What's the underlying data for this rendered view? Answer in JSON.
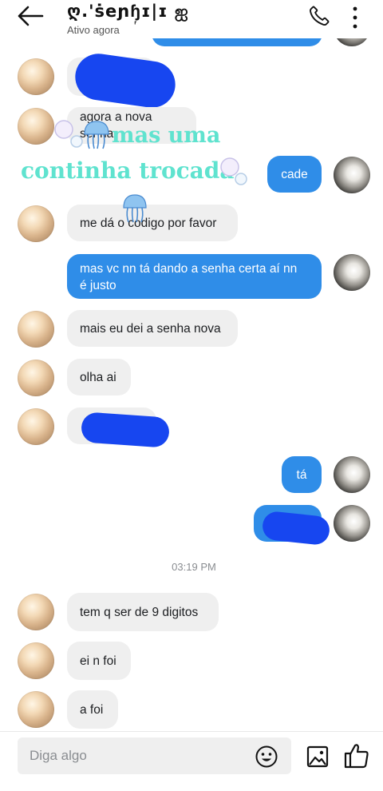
{
  "header": {
    "contact_name": "ღ.'ṡeɲɧ᷊ɪ|ɪ ஐ",
    "status": "Ativo agora"
  },
  "overlay": {
    "line1": "mas uma",
    "line2": "continha trocada"
  },
  "messages": {
    "m2_text": "agora a nova senha",
    "m3_text": "cade",
    "m4_text": "me dá o codigo por favor",
    "m5_line1": "mas vc nn tá dando a senha certa aí nn",
    "m5_line2": "é justo",
    "m6_text": "mais eu dei a senha nova",
    "m7_text": "olha ai",
    "m9_text": "tá",
    "timestamp": "03:19 PM",
    "m11_text": "tem q ser de 9 digitos",
    "m12_text": "ei n foi",
    "m13_text": "a foi"
  },
  "composer": {
    "placeholder": "Diga algo"
  },
  "colors": {
    "outgoing_bubble": "#2f8de8",
    "incoming_bubble": "#efefef",
    "redaction_blob": "#1746f0",
    "overlay_text": "#5fe3cf"
  },
  "icons": {
    "back": "arrow-left-icon",
    "call": "phone-icon",
    "more": "vertical-dots-icon",
    "emoji": "smiley-icon",
    "image": "image-icon",
    "like": "thumbs-up-icon"
  }
}
